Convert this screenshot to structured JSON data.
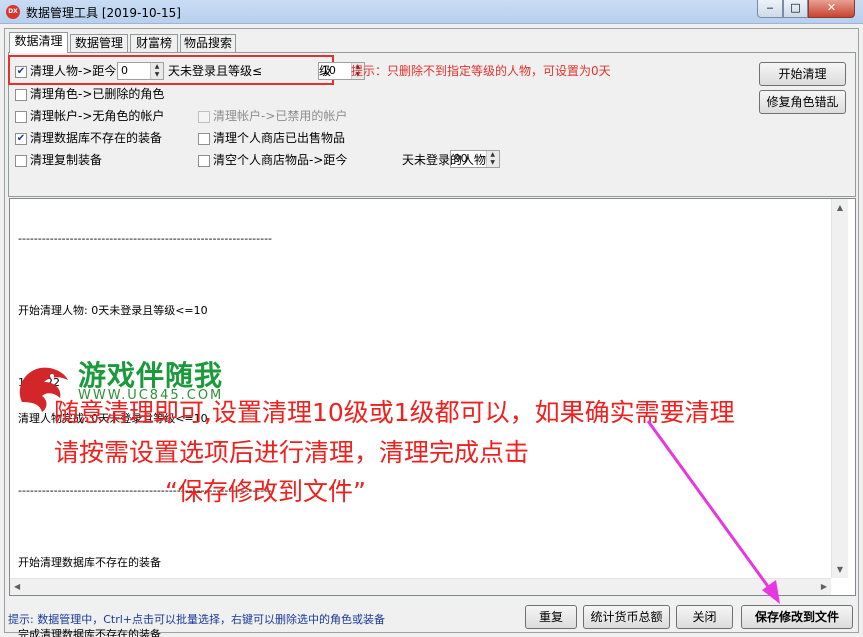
{
  "window": {
    "icon_text": "DX",
    "title": "数据管理工具 [2019-10-15]",
    "min_label": "‒",
    "max_label": "□",
    "close_label": "✕"
  },
  "tabs": [
    {
      "label": "数据清理",
      "active": true
    },
    {
      "label": "数据管理",
      "active": false
    },
    {
      "label": "财富榜",
      "active": false
    },
    {
      "label": "物品搜索",
      "active": false
    }
  ],
  "options": {
    "clean_char": {
      "label": "清理人物->距今",
      "checked": true,
      "days": "0",
      "mid": "天未登录且等级≤",
      "level": "10",
      "suffix": "级"
    },
    "tip": "提示：只删除不到指定等级的人物，可设置为0天",
    "clean_role": {
      "label": "清理角色->已删除的角色",
      "checked": false
    },
    "clean_account_norole": {
      "label": "清理帐户->无角色的帐户",
      "checked": false
    },
    "clean_account_disabled": {
      "label": "清理帐户->已禁用的帐户",
      "checked": false,
      "disabled": true
    },
    "clean_db_equip": {
      "label": "清理数据库不存在的装备",
      "checked": true
    },
    "clean_shop_sold": {
      "label": "清理个人商店已出售物品",
      "checked": false
    },
    "clean_dup_equip": {
      "label": "清理复制装备",
      "checked": false
    },
    "clear_shop": {
      "label": "清空个人商店物品->距今",
      "checked": false,
      "days": "90",
      "suffix": "天未登录的人物"
    }
  },
  "side_buttons": {
    "start": "开始清理",
    "repair": "修复角色错乱"
  },
  "log": [
    "----------------------------------------------------------------",
    "",
    "开始清理人物: 0天未登录且等级<=10",
    "",
    "111222",
    "清理人物完成: 0天未登录且等级<=10",
    "",
    "----------------------------------------------------------------",
    "",
    "开始清理数据库不存在的装备",
    "",
    "完成清理数据库不存在的装备"
  ],
  "overlay": {
    "logo_text": "游戏伴随我",
    "logo_url": "WWW.UC845.COM",
    "line1": "随意清理即可,设置清理10级或1级都可以，如果确实需要清理",
    "line2": "请按需设置选项后进行清理，清理完成点击",
    "line3": "“保存修改到文件”",
    "accent": "#f0201e",
    "arrow_color": "#e637e0"
  },
  "status_hint": "提示: 数据管理中，Ctrl+点击可以批量选择，右键可以删除选中的角色或装备",
  "bottom_buttons": {
    "reset": "重复",
    "stats": "统计货币总额",
    "close": "关闭",
    "save": "保存修改到文件"
  }
}
